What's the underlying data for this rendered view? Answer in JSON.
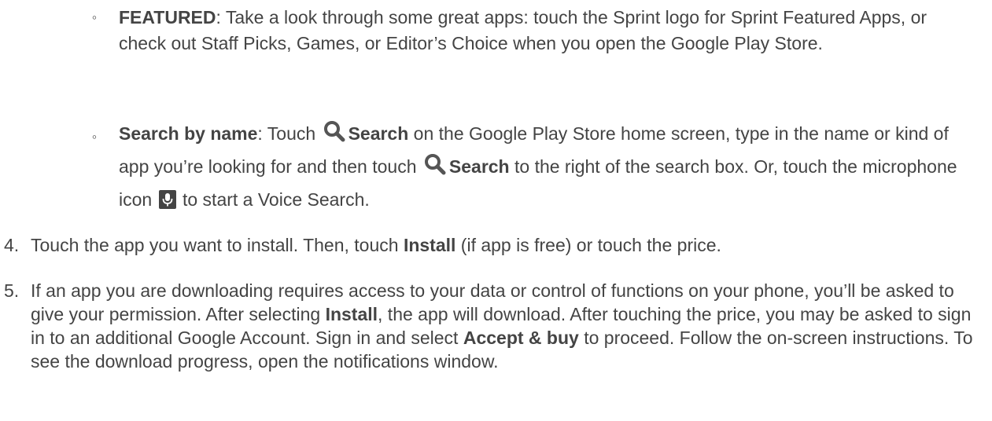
{
  "featured": {
    "bullet": "◦",
    "term": "FEATURED",
    "text": ": Take a look through some great apps: touch the Sprint logo for Sprint Featured Apps, or check out Staff Picks, Games, or Editor’s Choice when you open the Google Play Store."
  },
  "search_by_name": {
    "bullet": "◦",
    "term": "Search by name",
    "text_a": ": Touch ",
    "search_label_1": "Search",
    "text_b": " on the Google Play Store home screen, type in the name or kind of app you’re looking for and then touch ",
    "search_label_2": "Search",
    "text_c": " to the right of the search box. Or, touch the microphone icon ",
    "text_d": " to start a Voice Search.",
    "icons": [
      "search-icon",
      "search-icon",
      "microphone-icon"
    ]
  },
  "step4": {
    "number": "4.",
    "text_a": "Touch the app you want to install. Then, touch ",
    "install": "Install",
    "text_b": " (if app is free) or touch the price."
  },
  "step5": {
    "number": "5.",
    "text_a": "If an app you are downloading requires access to your data or control of functions on your phone, you’ll be asked to give your permission. After selecting ",
    "install": "Install",
    "text_b": ", the app will download. After touching the price, you may be asked to sign in to an additional Google Account. Sign in and select ",
    "accept": "Accept & buy",
    "text_c": " to proceed. Follow the on-screen instructions. To see the download progress, open the notifications window."
  },
  "colors": {
    "text": "#444444",
    "icon": "#555555",
    "background": "#ffffff"
  }
}
